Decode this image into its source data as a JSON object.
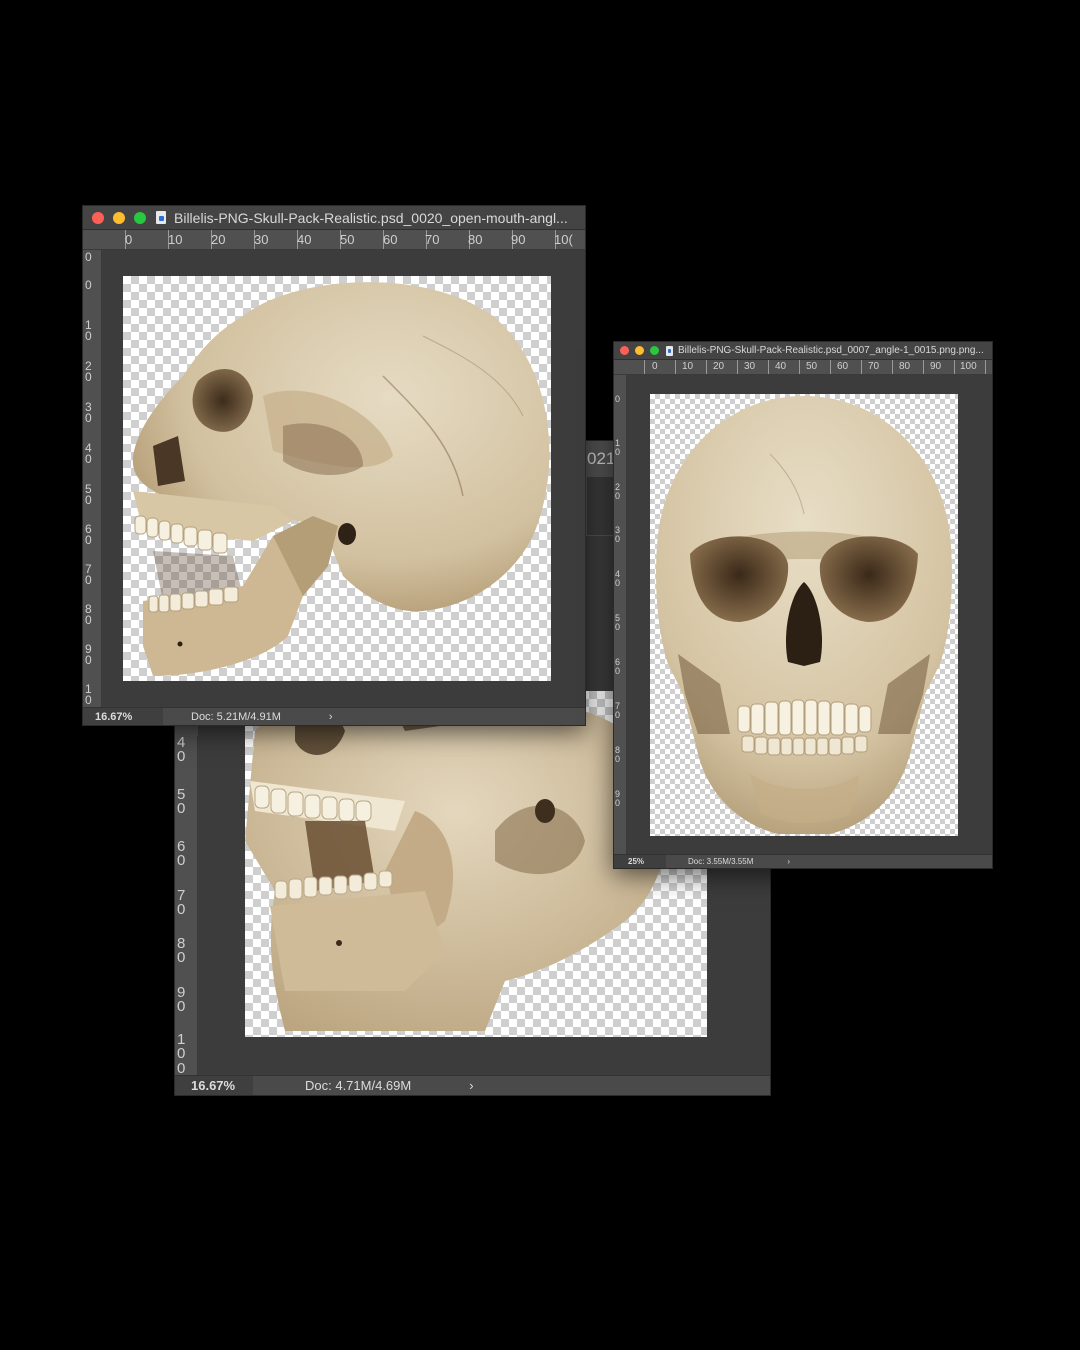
{
  "windows": {
    "back": {
      "title_fragment": "021",
      "ruler_v": [
        "4\n0",
        "5\n0",
        "6\n0",
        "7\n0",
        "8\n0",
        "9\n0",
        "1\n0\n0"
      ],
      "zoom": "16.67%",
      "doc": "Doc: 4.71M/4.69M",
      "arrow": "›"
    },
    "left": {
      "title": "Billelis-PNG-Skull-Pack-Realistic.psd_0020_open-mouth-angl...",
      "ruler_h": [
        "0",
        "10",
        "20",
        "30",
        "40",
        "50",
        "60",
        "70",
        "80",
        "90",
        "10("
      ],
      "ruler_v": [
        "0",
        "0",
        "1\n0",
        "2\n0",
        "3\n0",
        "4\n0",
        "5\n0",
        "6\n0",
        "7\n0",
        "8\n0",
        "9\n0",
        "1\n0"
      ],
      "zoom": "16.67%",
      "doc": "Doc: 5.21M/4.91M",
      "arrow": "›"
    },
    "right": {
      "title": "Billelis-PNG-Skull-Pack-Realistic.psd_0007_angle-1_0015.png.png...",
      "ruler_h": [
        "0",
        "10",
        "20",
        "30",
        "40",
        "50",
        "60",
        "70",
        "80",
        "90",
        "100"
      ],
      "ruler_v": [
        "0",
        "1\n0",
        "2\n0",
        "3\n0",
        "4\n0",
        "5\n0",
        "6\n0",
        "7\n0",
        "8\n0",
        "9\n0"
      ],
      "zoom": "25%",
      "doc": "Doc: 3.55M/3.55M",
      "arrow": "›"
    }
  },
  "colors": {
    "bone_light": "#e3d6bd",
    "bone_mid": "#c9b594",
    "bone_dark": "#6e5a3e",
    "teeth": "#f1ead8"
  }
}
